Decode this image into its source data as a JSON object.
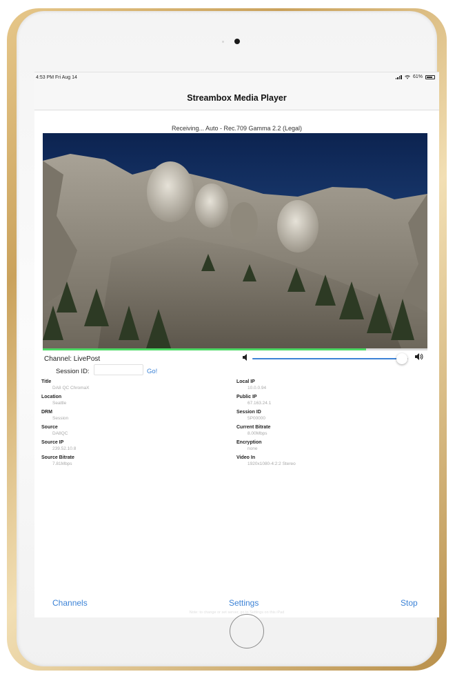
{
  "status_bar": {
    "time": "4:53 PM  Fri Aug 14",
    "battery": "61%"
  },
  "nav": {
    "title": "Streambox Media Player"
  },
  "stream": {
    "receiving_text": "Receiving... Auto - Rec.709 Gamma 2.2 (Legal)",
    "progress": 0.84
  },
  "controls": {
    "channel_label": "Channel: LivePost",
    "session_label": "Session ID:",
    "session_value": "",
    "go_label": "Go!",
    "volume": 0.96
  },
  "info_left": [
    {
      "label": "Title",
      "value": "DA8 QC ChromaX"
    },
    {
      "label": "Location",
      "value": "Seattle"
    },
    {
      "label": "DRM",
      "value": "Session"
    },
    {
      "label": "Source",
      "value": "DA8QC"
    },
    {
      "label": "Source IP",
      "value": "239.52.10.8"
    },
    {
      "label": "Source Bitrate",
      "value": "7.81Mbps"
    }
  ],
  "info_right": [
    {
      "label": "Local IP",
      "value": "10.0.0.94"
    },
    {
      "label": "Public IP",
      "value": "67.163.24.1"
    },
    {
      "label": "Session ID",
      "value": "5P00000"
    },
    {
      "label": "Current Bitrate",
      "value": "8.00Mbps"
    },
    {
      "label": "Encryption",
      "value": "none"
    },
    {
      "label": "Video In",
      "value": "1920x1080-4:2:2 Stereo"
    }
  ],
  "tabs": {
    "channels": "Channels",
    "settings": "Settings",
    "stop": "Stop"
  },
  "footer_note": "Note: to change or set server, go to Settings on this iPad",
  "colors": {
    "accent": "#3b82d6",
    "progress": "#4cd964",
    "frame_gold": "#caa25c"
  },
  "icons": {
    "signal": "signal-bars-icon",
    "wifi": "wifi-icon",
    "battery": "battery-icon",
    "volume_min": "speaker-low-icon",
    "volume_max": "speaker-high-icon"
  }
}
